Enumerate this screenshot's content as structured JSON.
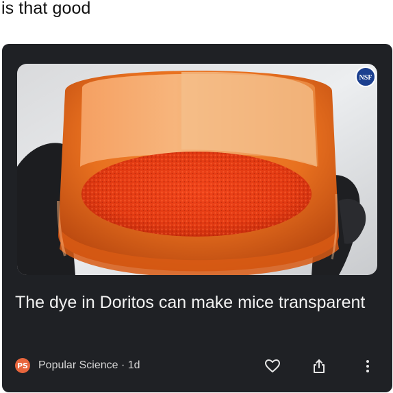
{
  "post": {
    "caption": "is that good"
  },
  "card": {
    "headline": "The dye in Doritos can make mice transparent",
    "source": "Popular Science · 1d",
    "source_logo_text": "PS",
    "image_badge_text": "NSF",
    "icons": {
      "source_logo": "popular-science-logo",
      "like": "heart-icon",
      "share": "share-icon",
      "more": "more-vertical-icon"
    },
    "colors": {
      "card_background": "#1f2125",
      "headline_text": "#f1f1f1",
      "source_logo": "#e8663d"
    }
  }
}
